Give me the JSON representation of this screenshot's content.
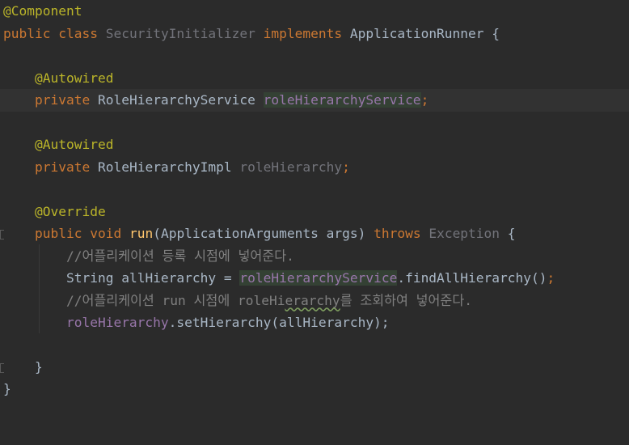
{
  "editor": {
    "l1": {
      "annotation": "@Component"
    },
    "l2": {
      "kw_public": "public",
      "kw_class": "class",
      "class_name": "SecurityInitializer",
      "kw_implements": "implements",
      "interface": "ApplicationRunner",
      "brace": "{"
    },
    "l4": {
      "annotation": "@Autowired"
    },
    "l5": {
      "kw": "private",
      "type": "RoleHierarchyService",
      "field": "roleHierarchyService",
      "semi": ";"
    },
    "l7": {
      "annotation": "@Autowired"
    },
    "l8": {
      "kw": "private",
      "type": "RoleHierarchyImpl",
      "field": "roleHierarchy",
      "semi": ";"
    },
    "l10": {
      "annotation": "@Override"
    },
    "l11": {
      "kw_public": "public",
      "kw_void": "void",
      "method": "run",
      "params": "(ApplicationArguments args)",
      "kw_throws": "throws",
      "exception": "Exception",
      "brace": "{"
    },
    "l12": {
      "comment": "//어플리케이션 등록 시점에 넣어준다."
    },
    "l13": {
      "type": "String",
      "var": "allHierarchy =",
      "field": "roleHierarchyService",
      "call": ".findAllHierarchy()",
      "semi": ";"
    },
    "l14": {
      "comment_a": "//어플리케이션 run 시점에 roleHi",
      "comment_typo": "erarchy",
      "comment_b": "를 조회하여 넣어준다."
    },
    "l15": {
      "field": "roleHierarchy",
      "call": ".setHierarchy(allHierarchy);"
    },
    "l17": {
      "brace": "}"
    },
    "l18": {
      "brace": "}"
    }
  }
}
